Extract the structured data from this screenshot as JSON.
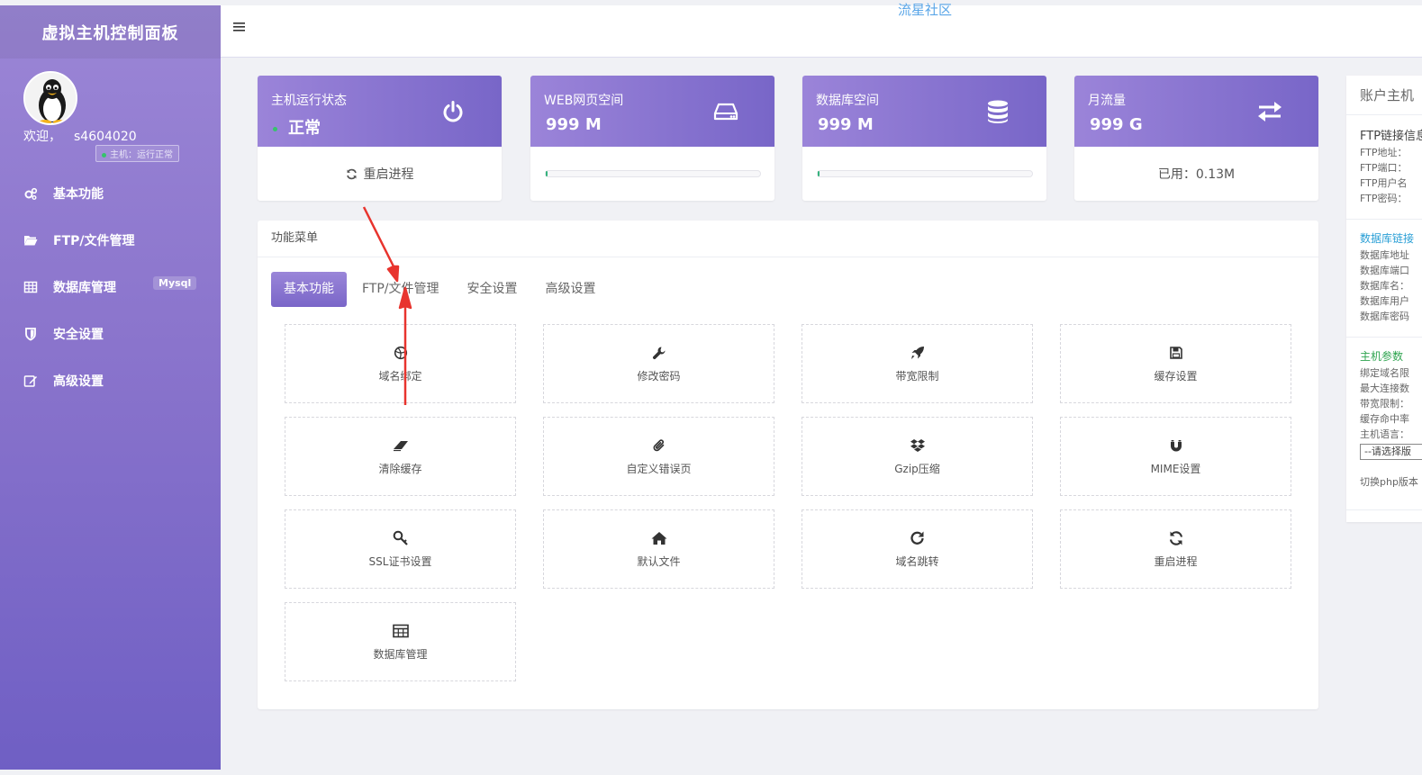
{
  "sidebar": {
    "brand": "虚拟主机控制面板",
    "welcome_label": "欢迎，",
    "username": "s4604020",
    "status_text": "主机：运行正常",
    "items": [
      {
        "label": "基本功能",
        "icon": "cogs-icon"
      },
      {
        "label": "FTP/文件管理",
        "icon": "folder-open-icon"
      },
      {
        "label": "数据库管理",
        "icon": "table-icon",
        "tag": "Mysql"
      },
      {
        "label": "安全设置",
        "icon": "shield-icon"
      },
      {
        "label": "高级设置",
        "icon": "edit-icon"
      }
    ]
  },
  "topbar": {
    "site_name": "流星社区",
    "menu_icon": "hamburger-menu-icon"
  },
  "stats": [
    {
      "label": "主机运行状态",
      "value": "正常",
      "icon": "power-icon",
      "footer": "重启进程",
      "footer_icon": "refresh-icon"
    },
    {
      "label": "WEB网页空间",
      "value": "999 M",
      "icon": "hdd-icon",
      "progress": 0.01
    },
    {
      "label": "数据库空间",
      "value": "999 M",
      "icon": "database-icon",
      "progress": 0.01
    },
    {
      "label": "月流量",
      "value": "999 G",
      "icon": "exchange-icon",
      "footer": "已用：0.13M"
    }
  ],
  "menu": {
    "title": "功能菜单",
    "tabs": [
      "基本功能",
      "FTP/文件管理",
      "安全设置",
      "高级设置"
    ],
    "active_tab": 0,
    "tiles": [
      {
        "label": "域名绑定",
        "icon": "globe-icon"
      },
      {
        "label": "修改密码",
        "icon": "wrench-icon"
      },
      {
        "label": "带宽限制",
        "icon": "rocket-icon"
      },
      {
        "label": "缓存设置",
        "icon": "save-icon"
      },
      {
        "label": "清除缓存",
        "icon": "eraser-icon"
      },
      {
        "label": "自定义错误页",
        "icon": "paperclip-icon"
      },
      {
        "label": "Gzip压缩",
        "icon": "dropbox-icon"
      },
      {
        "label": "MIME设置",
        "icon": "magnet-icon"
      },
      {
        "label": "SSL证书设置",
        "icon": "key-icon"
      },
      {
        "label": "默认文件",
        "icon": "home-icon"
      },
      {
        "label": "域名跳转",
        "icon": "redo-icon"
      },
      {
        "label": "重启进程",
        "icon": "refresh-icon"
      },
      {
        "label": "数据库管理",
        "icon": "table-icon"
      }
    ]
  },
  "account": {
    "title": "账户主机",
    "ftp": {
      "title": "FTP链接信息",
      "lines": [
        "FTP地址：",
        "FTP端口：",
        "FTP用户名",
        "FTP密码："
      ]
    },
    "db": {
      "title": "数据库链接",
      "lines": [
        "数据库地址",
        "数据库端口",
        "数据库名：",
        "数据库用户",
        "数据库密码"
      ]
    },
    "host": {
      "title": "主机参数",
      "lines": [
        "绑定域名限",
        "最大连接数",
        "带宽限制：",
        "缓存命中率",
        "主机语言："
      ],
      "select": "--请选择版"
    },
    "php_switch": "切换php版本"
  },
  "colors": {
    "accent": "#8a74cc",
    "db_title": "#2a9fd6",
    "host_title": "#2ea44f",
    "ok": "#36c36b",
    "annotation": "#e8342e"
  }
}
